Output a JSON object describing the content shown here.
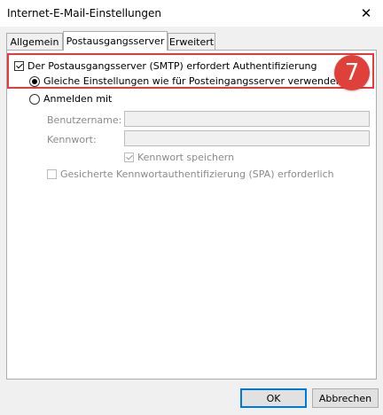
{
  "window": {
    "title": "Internet-E-Mail-Einstellungen",
    "close_glyph": "✕"
  },
  "tabs": [
    {
      "label": "Allgemein",
      "active": false
    },
    {
      "label": "Postausgangsserver",
      "active": true
    },
    {
      "label": "Erweitert",
      "active": false
    }
  ],
  "outgoing": {
    "smtp_auth_label": "Der Postausgangsserver (SMTP) erfordert Authentifizierung",
    "smtp_auth_checked": true,
    "same_settings_label": "Gleiche Einstellungen wie für Posteingangsserver verwenden",
    "same_settings_selected": true,
    "login_with_label": "Anmelden mit",
    "login_with_selected": false,
    "username_label": "Benutzername:",
    "username_value": "",
    "password_label": "Kennwort:",
    "password_value": "",
    "remember_password_label": "Kennwort speichern",
    "remember_password_checked": true,
    "spa_label": "Gesicherte Kennwortauthentifizierung (SPA) erforderlich",
    "spa_checked": false
  },
  "annotation": {
    "step_number": "7",
    "color": "#e0403a"
  },
  "buttons": {
    "ok_label": "OK",
    "cancel_label": "Abbrechen"
  },
  "colors": {
    "accent": "#0078d7",
    "highlight": "#e8393b"
  }
}
